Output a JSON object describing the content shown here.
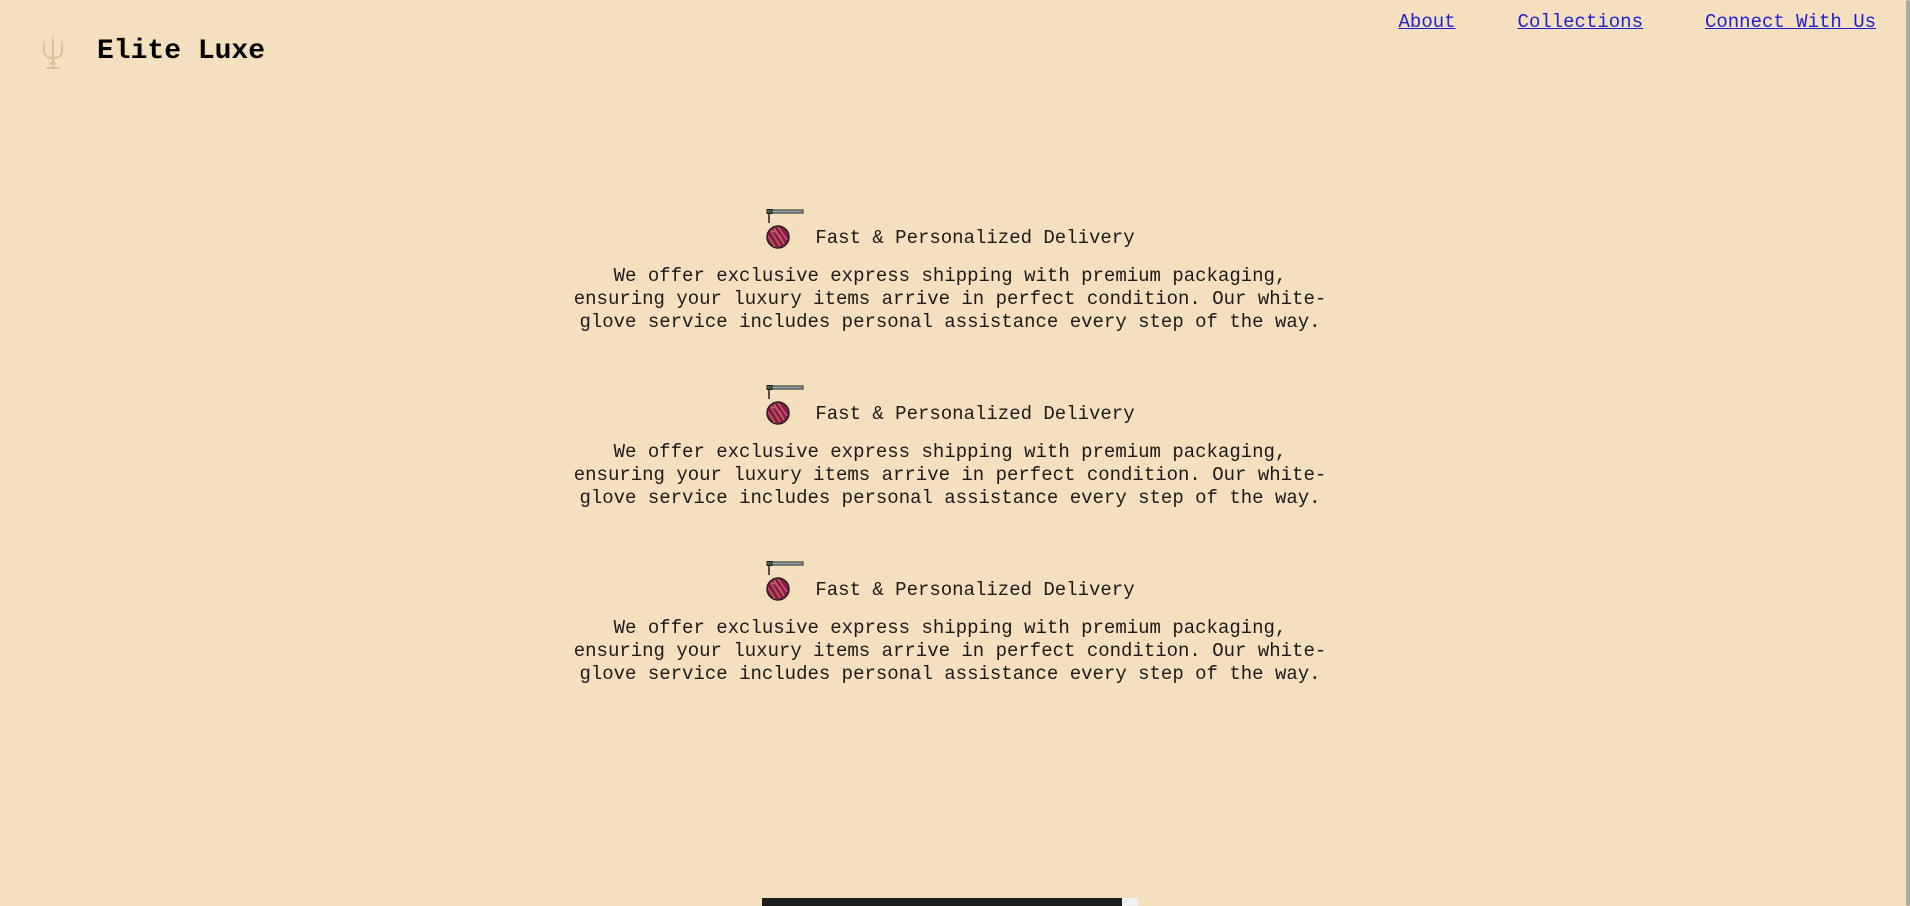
{
  "header": {
    "brand": "Elite Luxe",
    "logo_icon": "candelabra-icon",
    "nav": [
      {
        "label": "About"
      },
      {
        "label": "Collections"
      },
      {
        "label": "Connect With Us"
      }
    ]
  },
  "features": [
    {
      "icon": "yarn-ball-needle-icon",
      "title": "Fast & Personalized Delivery",
      "text": "We offer exclusive express shipping with premium packaging, ensuring your luxury items arrive in perfect condition. Our white-glove service includes personal assistance every step of the way."
    },
    {
      "icon": "yarn-ball-needle-icon",
      "title": "Fast & Personalized Delivery",
      "text": "We offer exclusive express shipping with premium packaging, ensuring your luxury items arrive in perfect condition. Our white-glove service includes personal assistance every step of the way."
    },
    {
      "icon": "yarn-ball-needle-icon",
      "title": "Fast & Personalized Delivery",
      "text": "We offer exclusive express shipping with premium packaging, ensuring your luxury items arrive in perfect condition. Our white-glove service includes personal assistance every step of the way."
    }
  ],
  "colors": {
    "background": "#f4e0bf",
    "link": "#1f1fd0",
    "yarn": "#8b1e3f"
  }
}
